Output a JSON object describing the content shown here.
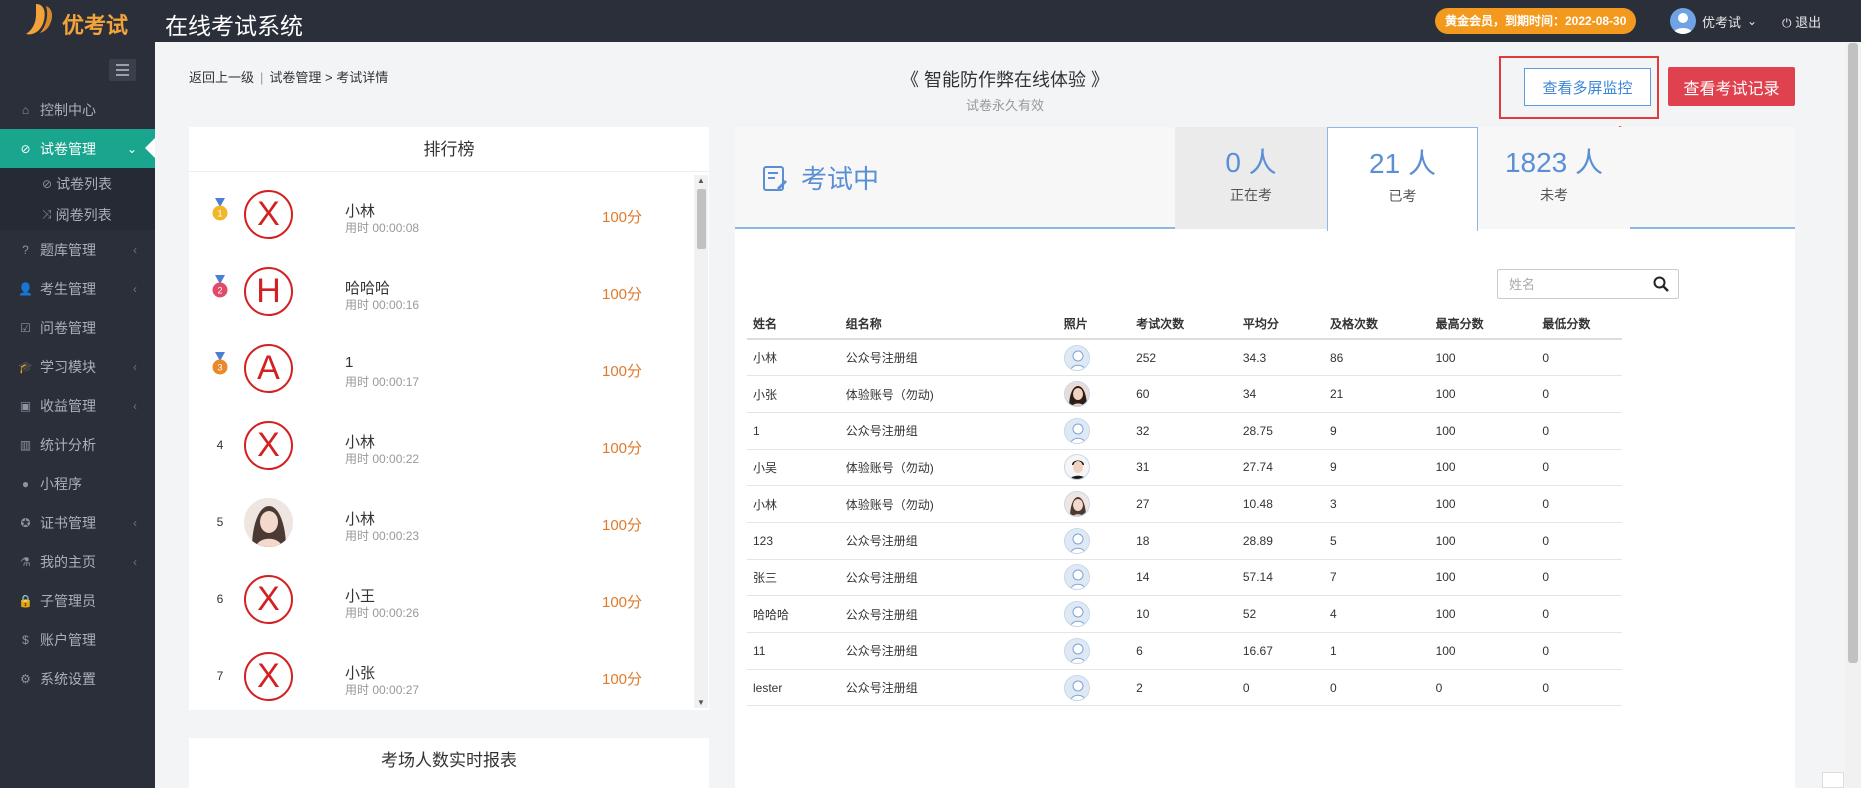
{
  "brand": {
    "name": "优考试",
    "system_title": "在线考试系统"
  },
  "header": {
    "member_badge": "黄金会员，到期时间：2022-08-30",
    "user_name": "优考试",
    "user_arrow": "⌄",
    "logout_label": "退出",
    "logout_icon": "power-icon"
  },
  "sidebar": {
    "items": [
      {
        "label": "控制中心",
        "icon": "home-icon",
        "arrow": ""
      },
      {
        "label": "试卷管理",
        "icon": "check-circle-icon",
        "arrow": "⌄",
        "active": true
      },
      {
        "label": "题库管理",
        "icon": "question-icon",
        "arrow": "‹"
      },
      {
        "label": "考生管理",
        "icon": "user-icon",
        "arrow": "‹"
      },
      {
        "label": "问卷管理",
        "icon": "checkbox-icon",
        "arrow": ""
      },
      {
        "label": "学习模块",
        "icon": "graduation-icon",
        "arrow": "‹"
      },
      {
        "label": "收益管理",
        "icon": "money-icon",
        "arrow": "‹"
      },
      {
        "label": "统计分析",
        "icon": "bar-chart-icon",
        "arrow": ""
      },
      {
        "label": "小程序",
        "icon": "wechat-icon",
        "arrow": ""
      },
      {
        "label": "证书管理",
        "icon": "certificate-icon",
        "arrow": "‹"
      },
      {
        "label": "我的主页",
        "icon": "flask-icon",
        "arrow": "‹"
      },
      {
        "label": "子管理员",
        "icon": "lock-icon",
        "arrow": ""
      },
      {
        "label": "账户管理",
        "icon": "dollar-icon",
        "arrow": ""
      },
      {
        "label": "系统设置",
        "icon": "gear-icon",
        "arrow": ""
      }
    ],
    "sub_items": [
      {
        "label": "试卷列表",
        "icon": "check-circle-icon"
      },
      {
        "label": "阅卷列表",
        "icon": "shuffle-icon"
      }
    ]
  },
  "breadcrumb": {
    "back": "返回上一级",
    "sep": "|",
    "path": "试卷管理 > 考试详情"
  },
  "exam": {
    "title": "《 智能防作弊在线体验 》",
    "subtitle": "试卷永久有效"
  },
  "actions": {
    "monitor_label": "查看多屏监控",
    "record_label": "查看考试记录"
  },
  "annotation": {
    "color": "#e03a3a"
  },
  "ranking": {
    "title": "排行榜",
    "items": [
      {
        "rank": "1",
        "medal": "gold",
        "avatar": "X",
        "name": "小林",
        "time": "用时 00:00:08",
        "score": "100分"
      },
      {
        "rank": "2",
        "medal": "silver",
        "avatar": "H",
        "name": "哈哈哈",
        "time": "用时 00:00:16",
        "score": "100分"
      },
      {
        "rank": "3",
        "medal": "bronze",
        "avatar": "A",
        "name": "1",
        "time": "用时 00:00:17",
        "score": "100分"
      },
      {
        "rank": "4",
        "medal": "",
        "avatar": "X",
        "name": "小林",
        "time": "用时 00:00:22",
        "score": "100分"
      },
      {
        "rank": "5",
        "medal": "",
        "avatar": "",
        "name": "小林",
        "time": "用时 00:00:23",
        "score": "100分"
      },
      {
        "rank": "6",
        "medal": "",
        "avatar": "X",
        "name": "小王",
        "time": "用时 00:00:26",
        "score": "100分"
      },
      {
        "rank": "7",
        "medal": "",
        "avatar": "X",
        "name": "小张",
        "time": "用时 00:00:27",
        "score": "100分"
      }
    ]
  },
  "report": {
    "title": "考场人数实时报表"
  },
  "status": {
    "label": "考试中",
    "stats": [
      {
        "num": "0 人",
        "label": "正在考"
      },
      {
        "num": "21 人",
        "label": "已考"
      },
      {
        "num": "1823 人",
        "label": "未考"
      }
    ]
  },
  "search": {
    "placeholder": "姓名"
  },
  "table": {
    "headers": [
      "姓名",
      "组名称",
      "照片",
      "考试次数",
      "平均分",
      "及格次数",
      "最高分数",
      "最低分数"
    ],
    "rows": [
      {
        "name": "小林",
        "group": "公众号注册组",
        "photo": "default",
        "count": "252",
        "avg": "34.3",
        "pass": "86",
        "max": "100",
        "min": "0"
      },
      {
        "name": "小张",
        "group": "体验账号（勿动)",
        "photo": "woman",
        "count": "60",
        "avg": "34",
        "pass": "21",
        "max": "100",
        "min": "0"
      },
      {
        "name": "1",
        "group": "公众号注册组",
        "photo": "default",
        "count": "32",
        "avg": "28.75",
        "pass": "9",
        "max": "100",
        "min": "0"
      },
      {
        "name": "小吴",
        "group": "体验账号（勿动)",
        "photo": "man",
        "count": "31",
        "avg": "27.74",
        "pass": "9",
        "max": "100",
        "min": "0"
      },
      {
        "name": "小林",
        "group": "体验账号（勿动)",
        "photo": "woman2",
        "count": "27",
        "avg": "10.48",
        "pass": "3",
        "max": "100",
        "min": "0"
      },
      {
        "name": "123",
        "group": "公众号注册组",
        "photo": "default",
        "count": "18",
        "avg": "28.89",
        "pass": "5",
        "max": "100",
        "min": "0"
      },
      {
        "name": "张三",
        "group": "公众号注册组",
        "photo": "default",
        "count": "14",
        "avg": "57.14",
        "pass": "7",
        "max": "100",
        "min": "0"
      },
      {
        "name": "哈哈哈",
        "group": "公众号注册组",
        "photo": "default",
        "count": "10",
        "avg": "52",
        "pass": "4",
        "max": "100",
        "min": "0"
      },
      {
        "name": "11",
        "group": "公众号注册组",
        "photo": "default",
        "count": "6",
        "avg": "16.67",
        "pass": "1",
        "max": "100",
        "min": "0"
      },
      {
        "name": "lester",
        "group": "公众号注册组",
        "photo": "default",
        "count": "2",
        "avg": "0",
        "pass": "0",
        "max": "0",
        "min": "0"
      }
    ]
  }
}
